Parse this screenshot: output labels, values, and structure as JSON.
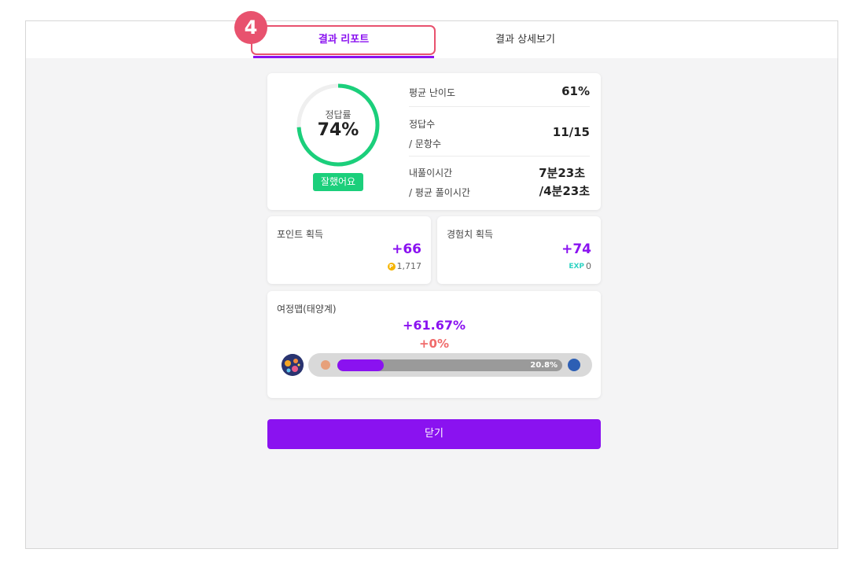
{
  "step_badge": "4",
  "tabs": [
    {
      "label": "결과 리포트",
      "active": true
    },
    {
      "label": "결과 상세보기",
      "active": false
    }
  ],
  "score": {
    "ring_label": "정답률",
    "ring_value": "74%",
    "ring_fraction": 0.74,
    "badge": "잘했어요",
    "stats": [
      {
        "label_line1": "평균 난이도",
        "label_line2": "",
        "value_line1": "61%",
        "value_line2": ""
      },
      {
        "label_line1": "정답수",
        "label_line2": "/ 문항수",
        "value_line1": "11/15",
        "value_line2": ""
      },
      {
        "label_line1": "내풀이시간",
        "label_line2": "/ 평균 풀이시간",
        "value_line1": "7분23초",
        "value_line2": "/4분23초"
      }
    ]
  },
  "points": {
    "title": "포인트 획득",
    "delta": "+66",
    "total": "1,717",
    "icon": "coin-icon"
  },
  "experience": {
    "title": "경험치 획득",
    "delta": "+74",
    "total": "0",
    "icon_text": "EXP"
  },
  "journey": {
    "title": "여정맵(태양계)",
    "progress_delta": "+61.67%",
    "secondary_delta": "+0%",
    "bar_label": "20.8%",
    "bar_fraction": 0.208
  },
  "close_label": "닫기",
  "colors": {
    "accent": "#8a12f0",
    "success": "#1bcf7b",
    "highlight": "#e8526e",
    "negative": "#f06b6b"
  }
}
